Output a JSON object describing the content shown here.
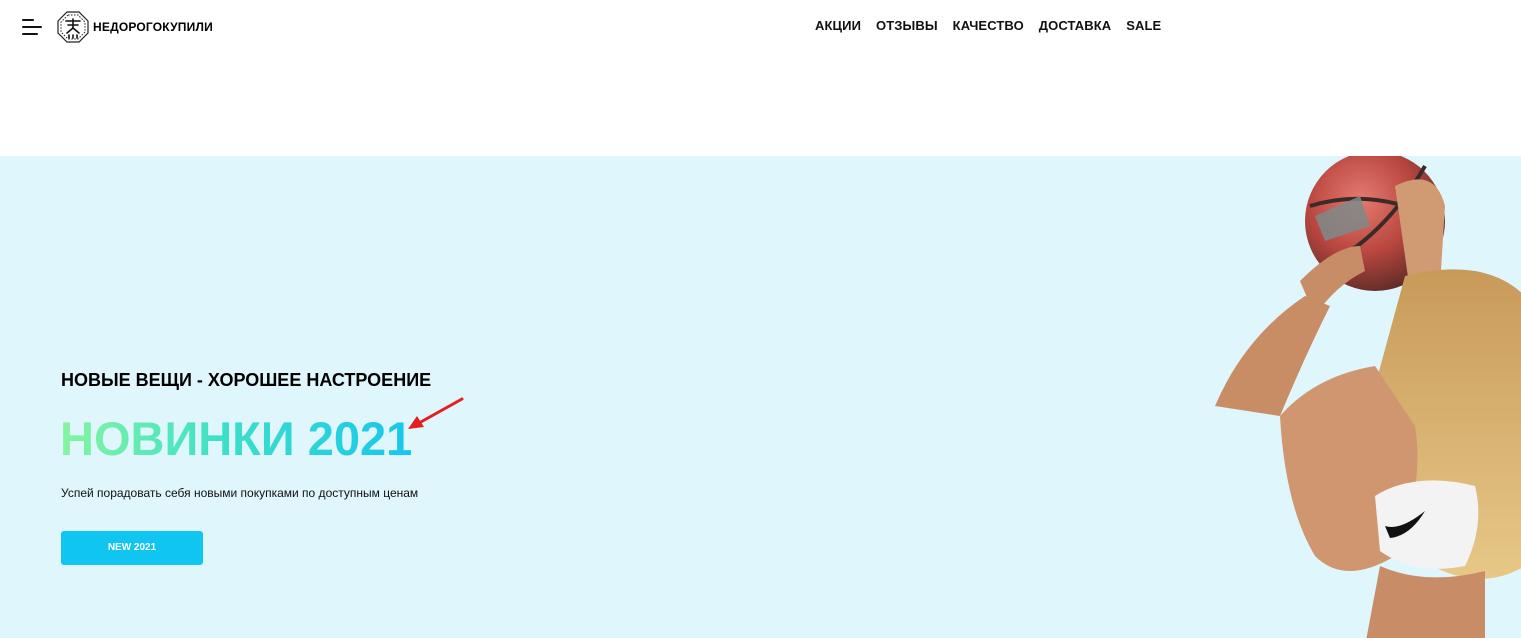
{
  "header": {
    "logo_text": "НЕДОРОГОКУПИЛИ",
    "nav": [
      "АКЦИИ",
      "ОТЗЫВЫ",
      "КАЧЕСТВО",
      "ДОСТАВКА",
      "SALE"
    ]
  },
  "hero": {
    "subtitle": "НОВЫЕ ВЕЩИ - ХОРОШЕЕ НАСТРОЕНИЕ",
    "title": "НОВИНКИ 2021",
    "description": "Успей порадовать себя новыми покупками по доступным ценам",
    "button_label": "NEW 2021",
    "background_color": "#dff6fc",
    "accent_color": "#10c6f1",
    "title_gradient": [
      "#86f59f",
      "#17c6ee"
    ]
  },
  "icons": {
    "menu": "hamburger-menu-icon",
    "logo": "logo-emblem-icon",
    "annotation": "red-arrow-icon"
  }
}
